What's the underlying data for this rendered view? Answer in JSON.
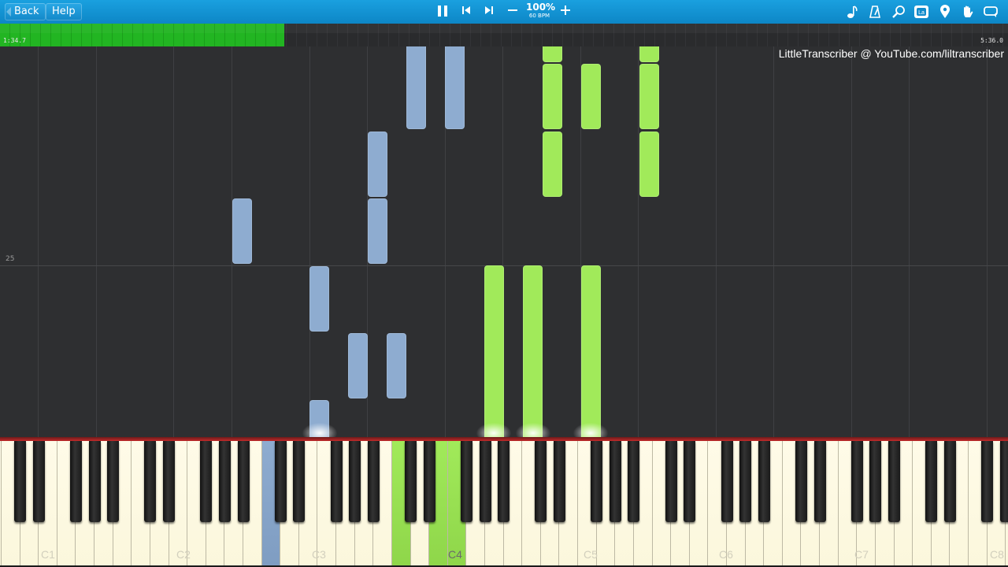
{
  "toolbar": {
    "back_label": "Back",
    "help_label": "Help",
    "tempo_percent": "100%",
    "tempo_bpm": "60 BPM",
    "icons": [
      "pause-icon",
      "skip-back-icon",
      "skip-forward-icon",
      "minus-icon",
      "plus-icon",
      "note-icon",
      "metronome-icon",
      "magnifier-icon",
      "label-icon",
      "location-pin-icon",
      "hand-icon",
      "loop-icon"
    ]
  },
  "progress": {
    "elapsed": "1:34.7",
    "total": "5:36.0",
    "fraction": 0.282,
    "accent": "#22b522"
  },
  "roll": {
    "credit": "LittleTranscriber @ YouTube.com/liltranscriber",
    "measure_number": "25",
    "left_hand_color": "#8eacd0",
    "right_hand_color": "#a1ea5a"
  },
  "keyboard": {
    "octave_labels": [
      "C1",
      "C2",
      "C3",
      "C4",
      "C5",
      "C6",
      "C7",
      "C8"
    ]
  }
}
